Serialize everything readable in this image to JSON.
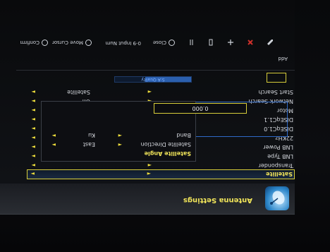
{
  "header": {
    "title": "Antenna Settings"
  },
  "settings": [
    {
      "label": "Satellite",
      "value": "",
      "selected": true
    },
    {
      "label": "Transponder",
      "value": ""
    },
    {
      "label": "LNB Type",
      "value": ""
    },
    {
      "label": "LNB Power",
      "value": ""
    },
    {
      "label": "22KHz",
      "value": ""
    },
    {
      "label": "DiSEqC1.0",
      "value": ""
    },
    {
      "label": "DiSEqC1.1",
      "value": ""
    },
    {
      "label": "Motor",
      "value": ""
    },
    {
      "label": "Network Search",
      "value": "Off"
    },
    {
      "label": "Start Search",
      "value": "Satellite"
    }
  ],
  "progress": {
    "label": "S:A Quality",
    "fraction": 0.6
  },
  "popup": {
    "rows": [
      {
        "label": "Satellite Angle",
        "value": "",
        "highlight": true
      },
      {
        "label": "Satellite Direction",
        "value": "East"
      },
      {
        "label": "Band",
        "value": "Ku"
      }
    ],
    "angle_value": "0.000"
  },
  "footer": {
    "add_label": "Add",
    "close_label": "Close",
    "move_cursor_label": "Move Cursor",
    "input_num_label": "0-9 Input Num",
    "confirm_label": "Confirm",
    "colors": {
      "red": "#d0302a",
      "green": "#38b04a",
      "yellow": "#e8d23a",
      "blue": "#3a6fd8"
    }
  }
}
